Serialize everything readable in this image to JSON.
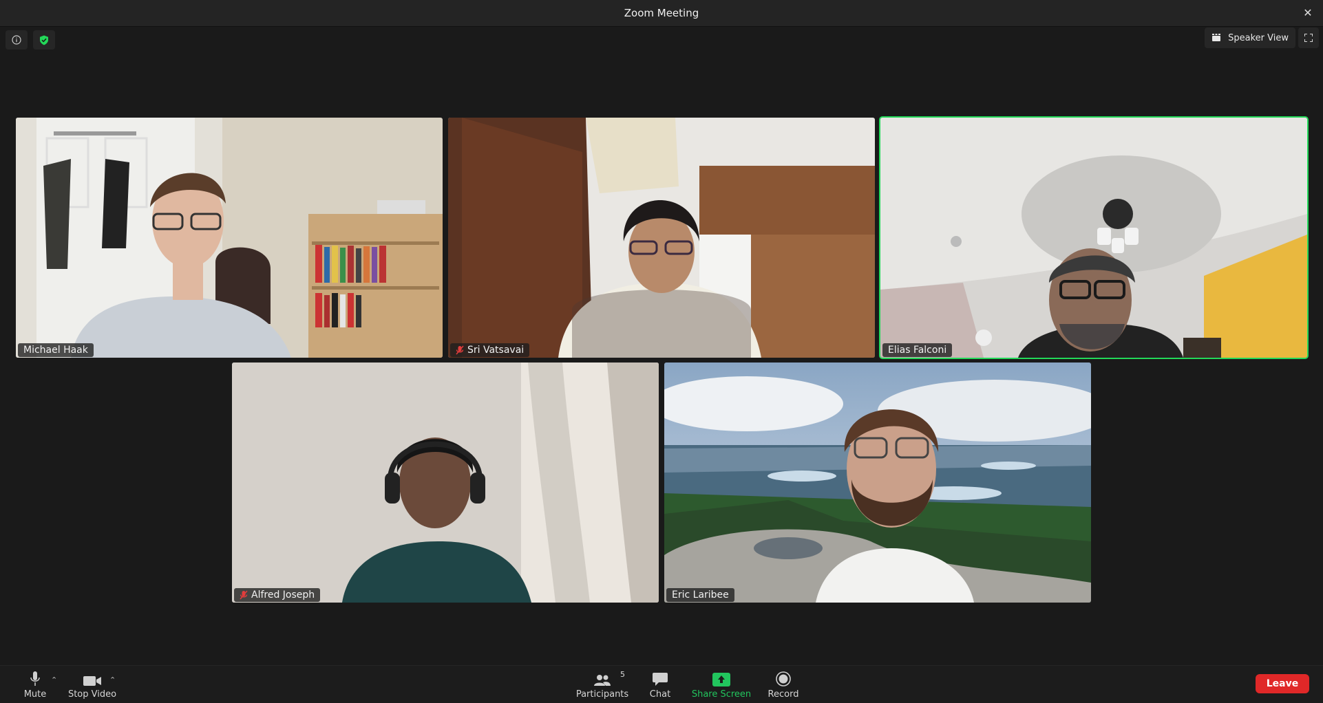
{
  "window": {
    "title": "Zoom Meeting",
    "close_label": "✕"
  },
  "top_controls": {
    "speaker_view_label": "Speaker View"
  },
  "participants": [
    {
      "name": "Michael Haak",
      "muted": false,
      "active_speaker": false
    },
    {
      "name": "Sri Vatsavai",
      "muted": true,
      "active_speaker": false
    },
    {
      "name": "Elias Falconi",
      "muted": false,
      "active_speaker": true
    },
    {
      "name": "Alfred Joseph",
      "muted": true,
      "active_speaker": false
    },
    {
      "name": "Eric Laribee",
      "muted": false,
      "active_speaker": false
    }
  ],
  "toolbar": {
    "mute_label": "Mute",
    "stop_video_label": "Stop Video",
    "participants_label": "Participants",
    "participants_count": "5",
    "chat_label": "Chat",
    "share_screen_label": "Share Screen",
    "record_label": "Record",
    "leave_label": "Leave"
  },
  "colors": {
    "accent_green": "#23d959",
    "leave_red": "#e02828",
    "background": "#1a1a1a"
  }
}
